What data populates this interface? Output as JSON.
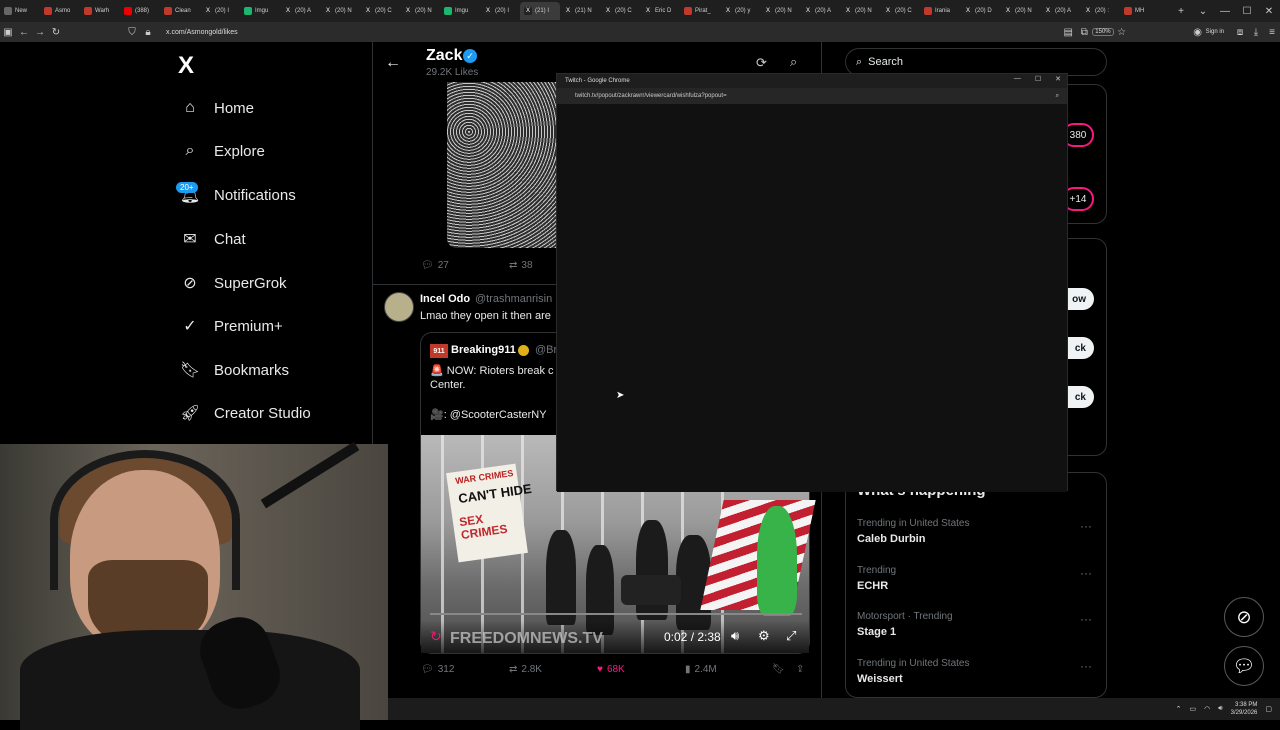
{
  "browser": {
    "tabs": [
      {
        "label": "New",
        "icon": "browser-icon"
      },
      {
        "label": "Asmo",
        "icon": "site-icon"
      },
      {
        "label": "Warh",
        "icon": "site-icon"
      },
      {
        "label": "(388)",
        "icon": "youtube-icon"
      },
      {
        "label": "Clean",
        "icon": "site-icon"
      },
      {
        "label": "(20) I",
        "icon": "x-icon"
      },
      {
        "label": "Imgu",
        "icon": "imgur-icon"
      },
      {
        "label": "(20) A",
        "icon": "x-icon"
      },
      {
        "label": "(20) N",
        "icon": "x-icon"
      },
      {
        "label": "(20) C",
        "icon": "x-icon"
      },
      {
        "label": "(20) N",
        "icon": "x-icon"
      },
      {
        "label": "Imgu",
        "icon": "imgur-icon"
      },
      {
        "label": "(20) I",
        "icon": "x-icon"
      },
      {
        "label": "(21) I",
        "icon": "x-icon"
      },
      {
        "label": "(21) N",
        "icon": "x-icon"
      },
      {
        "label": "(20) C",
        "icon": "x-icon"
      },
      {
        "label": "Eric D",
        "icon": "x-icon"
      },
      {
        "label": "Pirat_",
        "icon": "site-icon"
      },
      {
        "label": "(20) y",
        "icon": "x-icon"
      },
      {
        "label": "(20) N",
        "icon": "x-icon"
      },
      {
        "label": "(20) A",
        "icon": "x-icon"
      },
      {
        "label": "(20) N",
        "icon": "x-icon"
      },
      {
        "label": "(20) C",
        "icon": "x-icon"
      },
      {
        "label": "Irania",
        "icon": "site-icon"
      },
      {
        "label": "(20) D",
        "icon": "x-icon"
      },
      {
        "label": "(20) N",
        "icon": "x-icon"
      },
      {
        "label": "(20) A",
        "icon": "x-icon"
      },
      {
        "label": "(20) :",
        "icon": "x-icon"
      },
      {
        "label": "MH",
        "icon": "site-icon"
      }
    ],
    "active_tab_index": 13,
    "url": "x.com/Asmongold/likes",
    "zoom": "150%",
    "sign_in": "Sign in"
  },
  "x_nav": {
    "logo": "X",
    "badge": "20+",
    "items": [
      {
        "label": "Home",
        "icon": "home-icon"
      },
      {
        "label": "Explore",
        "icon": "search-icon"
      },
      {
        "label": "Notifications",
        "icon": "bell-icon"
      },
      {
        "label": "Chat",
        "icon": "mail-icon"
      },
      {
        "label": "SuperGrok",
        "icon": "grok-icon"
      },
      {
        "label": "Premium+",
        "icon": "verified-badge-icon"
      },
      {
        "label": "Bookmarks",
        "icon": "bookmark-icon"
      },
      {
        "label": "Creator Studio",
        "icon": "rocket-icon"
      }
    ]
  },
  "profile_header": {
    "name": "Zack",
    "likes": "29.2K Likes"
  },
  "post1": {
    "replies": "27",
    "reposts": "38"
  },
  "post2": {
    "author": "Incel Odo",
    "handle": "@trashmanrisin",
    "text": "Lmao they open it then are",
    "quote": {
      "badge": "911",
      "author": "Breaking911",
      "handle": "@Br",
      "text_line1": "🚨 NOW: Rioters break c",
      "text_line2": "Center.",
      "credit": "🎥: @ScooterCasterNY",
      "video": {
        "sign_top": "WAR CRIMES",
        "sign_mid": "CAN'T HIDE",
        "sign_bottom": "SEX CRIMES",
        "watermark": "FREEDOMNEWS.TV",
        "time": "0:02 / 2:38"
      }
    },
    "replies": "312",
    "reposts": "2.8K",
    "likes": "68K",
    "views": "2.4M"
  },
  "right": {
    "search_placeholder": "Search",
    "pill1": "380",
    "pill2": "+14",
    "follow": "ow",
    "back1": "ck",
    "back2": "ck",
    "whats_happening": "What's happening",
    "trends": [
      {
        "meta": "Trending in United States",
        "name": "Caleb Durbin"
      },
      {
        "meta": "Trending",
        "name": "ECHR"
      },
      {
        "meta": "Motorsport · Trending",
        "name": "Stage 1"
      },
      {
        "meta": "Trending in United States",
        "name": "Weissert"
      }
    ]
  },
  "popup": {
    "title": "Twitch - Google Chrome",
    "url": "twitch.tv/popout/zackrawrr/viewercard/wishfulza?popout="
  },
  "taskbar": {
    "time": "3:38 PM",
    "date": "3/29/2026"
  }
}
